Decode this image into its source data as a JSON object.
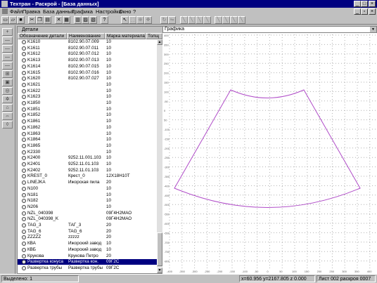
{
  "window": {
    "title": "Техтран - Раскрой - [База данных]"
  },
  "menu": [
    {
      "label": "Файл"
    },
    {
      "label": "Правка"
    },
    {
      "label": "База данных"
    },
    {
      "label": "Графика"
    },
    {
      "label": "Настройка"
    },
    {
      "label": "Окно"
    },
    {
      "label": "?"
    }
  ],
  "parts_panel": {
    "title": "Детали",
    "columns": [
      "Обозначение детали",
      "Наименование",
      "Марка материала",
      "Толщ"
    ],
    "rows": [
      {
        "id": "K1610",
        "name": "8102.90.07.009",
        "material": "10"
      },
      {
        "id": "K1611",
        "name": "8102.90.07.011",
        "material": "10"
      },
      {
        "id": "K1612",
        "name": "8102.90.07.012",
        "material": "10"
      },
      {
        "id": "K1613",
        "name": "8102.90.07.013",
        "material": "10"
      },
      {
        "id": "K1614",
        "name": "8102.90.07.015",
        "material": "10"
      },
      {
        "id": "K1615",
        "name": "8102.90.07.016",
        "material": "10"
      },
      {
        "id": "K1620",
        "name": "8102.90.07.027",
        "material": "10"
      },
      {
        "id": "K1621",
        "name": "",
        "material": "10"
      },
      {
        "id": "K1622",
        "name": "",
        "material": "10"
      },
      {
        "id": "K1623",
        "name": "",
        "material": "10"
      },
      {
        "id": "K1850",
        "name": "",
        "material": "10"
      },
      {
        "id": "K1851",
        "name": "",
        "material": "10"
      },
      {
        "id": "K1852",
        "name": "",
        "material": "10"
      },
      {
        "id": "K1861",
        "name": "",
        "material": "10"
      },
      {
        "id": "K1862",
        "name": "",
        "material": "10"
      },
      {
        "id": "K1863",
        "name": "",
        "material": "10"
      },
      {
        "id": "K1864",
        "name": "",
        "material": "10"
      },
      {
        "id": "K1865",
        "name": "",
        "material": "10"
      },
      {
        "id": "K2330",
        "name": "",
        "material": "10"
      },
      {
        "id": "K2400",
        "name": "9252.11.001.103",
        "material": "10"
      },
      {
        "id": "K2401",
        "name": "9252.11.01.103",
        "material": "10"
      },
      {
        "id": "K2402",
        "name": "9252.11.01.103",
        "material": "10"
      },
      {
        "id": "KREST_0",
        "name": "Крест_0",
        "material": "12Х18Н10Т"
      },
      {
        "id": "LINEJKA",
        "name": "Ижорская пила",
        "material": "20"
      },
      {
        "id": "N100",
        "name": "",
        "material": "10"
      },
      {
        "id": "N181",
        "name": "",
        "material": "10"
      },
      {
        "id": "N182",
        "name": "",
        "material": "10"
      },
      {
        "id": "N206",
        "name": "",
        "material": "10"
      },
      {
        "id": "NZL_040398",
        "name": "",
        "material": "09Г4Н2МАО"
      },
      {
        "id": "NZL_040398_K",
        "name": "",
        "material": "09Г4Н2МАО"
      },
      {
        "id": "TAG_3",
        "name": "ТАГ_3",
        "material": "20"
      },
      {
        "id": "TAG_6",
        "name": "TAG_6",
        "material": "20"
      },
      {
        "id": "ZZZZZ",
        "name": "zzzzz",
        "material": "20"
      },
      {
        "id": "КВА",
        "name": "Ижорский завод",
        "material": "10"
      },
      {
        "id": "КВБ",
        "name": "Ижорский завод",
        "material": "10"
      },
      {
        "id": "Крукова",
        "name": "Крукова Петро",
        "material": "20"
      },
      {
        "id": "Развертка конуса",
        "name": "Развертка кон.",
        "material": "09Г2С",
        "selected": true
      },
      {
        "id": "Развертка трубы",
        "name": "Развертка трубы",
        "material": "09Г2С"
      }
    ]
  },
  "graphics_panel": {
    "combo_value": "Графика",
    "y_ticks": [
      "400",
      "350",
      "300",
      "250",
      "200",
      "150",
      "100",
      "-50",
      "0",
      "50",
      "-100",
      "-150",
      "-200",
      "-250",
      "-300",
      "-350",
      "-400",
      "-450",
      "-500",
      "-550",
      "-600",
      "-650",
      "-700",
      "-750",
      "-800"
    ],
    "x_ticks": [
      "-400",
      "-350",
      "-300",
      "-250",
      "-200",
      "-150",
      "-100",
      "-50",
      "0",
      "50",
      "100",
      "150",
      "200",
      "250",
      "300",
      "350",
      "400"
    ],
    "shape_color": "#b04cc8"
  },
  "status": {
    "selected": "Выделено: 1",
    "coords": "x=60.956 y=2167.805 z 0.000",
    "sheet": "Лист 002 раскроя 0007"
  }
}
